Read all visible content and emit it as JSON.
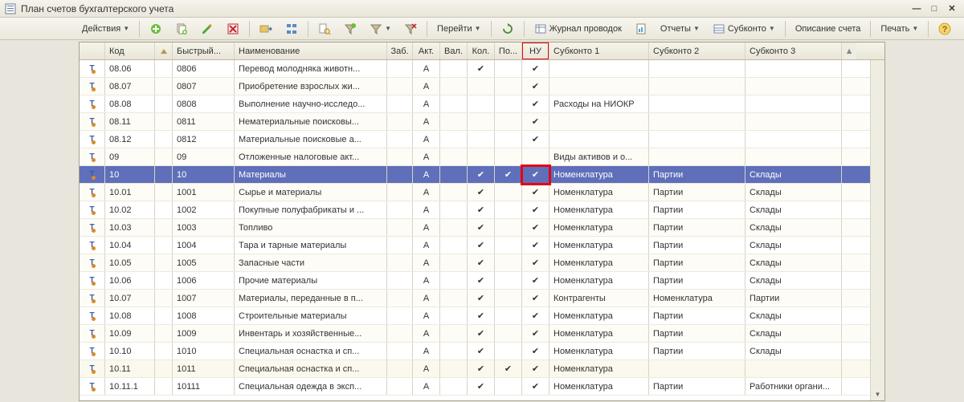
{
  "title": "План счетов бухгалтерского учета",
  "toolbar": {
    "actions": "Действия",
    "goto": "Перейти",
    "journal": "Журнал проводок",
    "reports": "Отчеты",
    "subkonto": "Субконто",
    "desc": "Описание счета",
    "print": "Печать"
  },
  "columns": {
    "code": "Код",
    "quick": "Быстрый...",
    "name": "Наименование",
    "zab": "Заб.",
    "akt": "Акт.",
    "val": "Вал.",
    "kol": "Кол.",
    "po": "По...",
    "nu": "НУ",
    "sub1": "Субконто 1",
    "sub2": "Субконто 2",
    "sub3": "Субконто 3"
  },
  "check": "✔",
  "akt_a": "А",
  "rows": [
    {
      "code": "08.06",
      "quick": "0806",
      "name": "Перевод молодняка животн...",
      "akt": "А",
      "val": false,
      "kol": true,
      "po": false,
      "nu": true,
      "s1": "",
      "s2": "",
      "s3": ""
    },
    {
      "code": "08.07",
      "quick": "0807",
      "name": "Приобретение взрослых жи...",
      "akt": "А",
      "val": false,
      "kol": false,
      "po": false,
      "nu": true,
      "s1": "",
      "s2": "",
      "s3": ""
    },
    {
      "code": "08.08",
      "quick": "0808",
      "name": "Выполнение научно-исследо...",
      "akt": "А",
      "val": false,
      "kol": false,
      "po": false,
      "nu": true,
      "s1": "Расходы на НИОКР",
      "s2": "",
      "s3": ""
    },
    {
      "code": "08.11",
      "quick": "0811",
      "name": "Нематериальные поисковы...",
      "akt": "А",
      "val": false,
      "kol": false,
      "po": false,
      "nu": true,
      "s1": "",
      "s2": "",
      "s3": ""
    },
    {
      "code": "08.12",
      "quick": "0812",
      "name": "Материальные поисковые а...",
      "akt": "А",
      "val": false,
      "kol": false,
      "po": false,
      "nu": true,
      "s1": "",
      "s2": "",
      "s3": ""
    },
    {
      "code": "09",
      "quick": "09",
      "name": "Отложенные налоговые акт...",
      "akt": "А",
      "val": false,
      "kol": false,
      "po": false,
      "nu": false,
      "s1": "Виды активов и о...",
      "s2": "",
      "s3": ""
    },
    {
      "code": "10",
      "quick": "10",
      "name": "Материалы",
      "akt": "А",
      "val": false,
      "kol": true,
      "po": true,
      "nu": true,
      "s1": "Номенклатура",
      "s2": "Партии",
      "s3": "Склады",
      "selected": true
    },
    {
      "code": "10.01",
      "quick": "1001",
      "name": "Сырье и материалы",
      "akt": "А",
      "val": false,
      "kol": true,
      "po": false,
      "nu": true,
      "s1": "Номенклатура",
      "s2": "Партии",
      "s3": "Склады"
    },
    {
      "code": "10.02",
      "quick": "1002",
      "name": "Покупные полуфабрикаты и ...",
      "akt": "А",
      "val": false,
      "kol": true,
      "po": false,
      "nu": true,
      "s1": "Номенклатура",
      "s2": "Партии",
      "s3": "Склады"
    },
    {
      "code": "10.03",
      "quick": "1003",
      "name": "Топливо",
      "akt": "А",
      "val": false,
      "kol": true,
      "po": false,
      "nu": true,
      "s1": "Номенклатура",
      "s2": "Партии",
      "s3": "Склады"
    },
    {
      "code": "10.04",
      "quick": "1004",
      "name": "Тара и тарные материалы",
      "akt": "А",
      "val": false,
      "kol": true,
      "po": false,
      "nu": true,
      "s1": "Номенклатура",
      "s2": "Партии",
      "s3": "Склады"
    },
    {
      "code": "10.05",
      "quick": "1005",
      "name": "Запасные части",
      "akt": "А",
      "val": false,
      "kol": true,
      "po": false,
      "nu": true,
      "s1": "Номенклатура",
      "s2": "Партии",
      "s3": "Склады"
    },
    {
      "code": "10.06",
      "quick": "1006",
      "name": "Прочие материалы",
      "akt": "А",
      "val": false,
      "kol": true,
      "po": false,
      "nu": true,
      "s1": "Номенклатура",
      "s2": "Партии",
      "s3": "Склады"
    },
    {
      "code": "10.07",
      "quick": "1007",
      "name": "Материалы, переданные в п...",
      "akt": "А",
      "val": false,
      "kol": true,
      "po": false,
      "nu": true,
      "s1": "Контрагенты",
      "s2": "Номенклатура",
      "s3": "Партии"
    },
    {
      "code": "10.08",
      "quick": "1008",
      "name": "Строительные материалы",
      "akt": "А",
      "val": false,
      "kol": true,
      "po": false,
      "nu": true,
      "s1": "Номенклатура",
      "s2": "Партии",
      "s3": "Склады"
    },
    {
      "code": "10.09",
      "quick": "1009",
      "name": "Инвентарь и хозяйственные...",
      "akt": "А",
      "val": false,
      "kol": true,
      "po": false,
      "nu": true,
      "s1": "Номенклатура",
      "s2": "Партии",
      "s3": "Склады"
    },
    {
      "code": "10.10",
      "quick": "1010",
      "name": "Специальная оснастка и сп...",
      "akt": "А",
      "val": false,
      "kol": true,
      "po": false,
      "nu": true,
      "s1": "Номенклатура",
      "s2": "Партии",
      "s3": "Склады"
    },
    {
      "code": "10.11",
      "quick": "1011",
      "name": "Специальная оснастка и сп...",
      "akt": "А",
      "val": false,
      "kol": true,
      "po": true,
      "nu": true,
      "s1": "Номенклатура",
      "s2": "",
      "s3": "",
      "alt": true
    },
    {
      "code": "10.11.1",
      "quick": "10111",
      "name": "Специальная одежда в эксп...",
      "akt": "А",
      "val": false,
      "kol": true,
      "po": false,
      "nu": true,
      "s1": "Номенклатура",
      "s2": "Партии",
      "s3": "Работники органи..."
    }
  ]
}
